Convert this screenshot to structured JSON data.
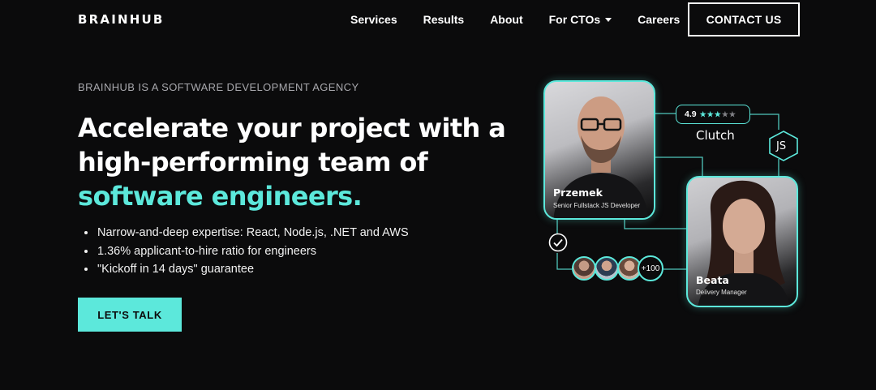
{
  "header": {
    "logo": "BRAINHUB",
    "nav": [
      {
        "label": "Services"
      },
      {
        "label": "Results"
      },
      {
        "label": "About"
      },
      {
        "label": "For CTOs",
        "has_dropdown": true
      },
      {
        "label": "Careers"
      }
    ],
    "contact_label": "CONTACT US"
  },
  "hero": {
    "eyebrow": "BRAINHUB IS A SOFTWARE DEVELOPMENT AGENCY",
    "headline_line1": "Accelerate your project with a",
    "headline_line2": "high-performing team of",
    "headline_accent": "software engineers.",
    "bullets": [
      "Narrow-and-deep expertise: React, Node.js, .NET and AWS",
      "1.36% applicant-to-hire ratio for engineers",
      "\"Kickoff in 14 days\" guarantee"
    ],
    "cta_label": "LET'S TALK"
  },
  "illustration": {
    "person1": {
      "name": "Przemek",
      "role": "Senior Fullstack JS Developer"
    },
    "person2": {
      "name": "Beata",
      "role": "Delivery Manager"
    },
    "rating": {
      "score": "4.9",
      "stars": 5,
      "source": "Clutch"
    },
    "tech_badge": "JS",
    "team_count": "+100"
  },
  "colors": {
    "background": "#0b0b0c",
    "accent": "#5ce8db",
    "text": "#ffffff",
    "muted": "#a8a8ad"
  },
  "icons": [
    "check-icon",
    "chevron-down-icon",
    "star-icon",
    "hexagon-icon"
  ]
}
